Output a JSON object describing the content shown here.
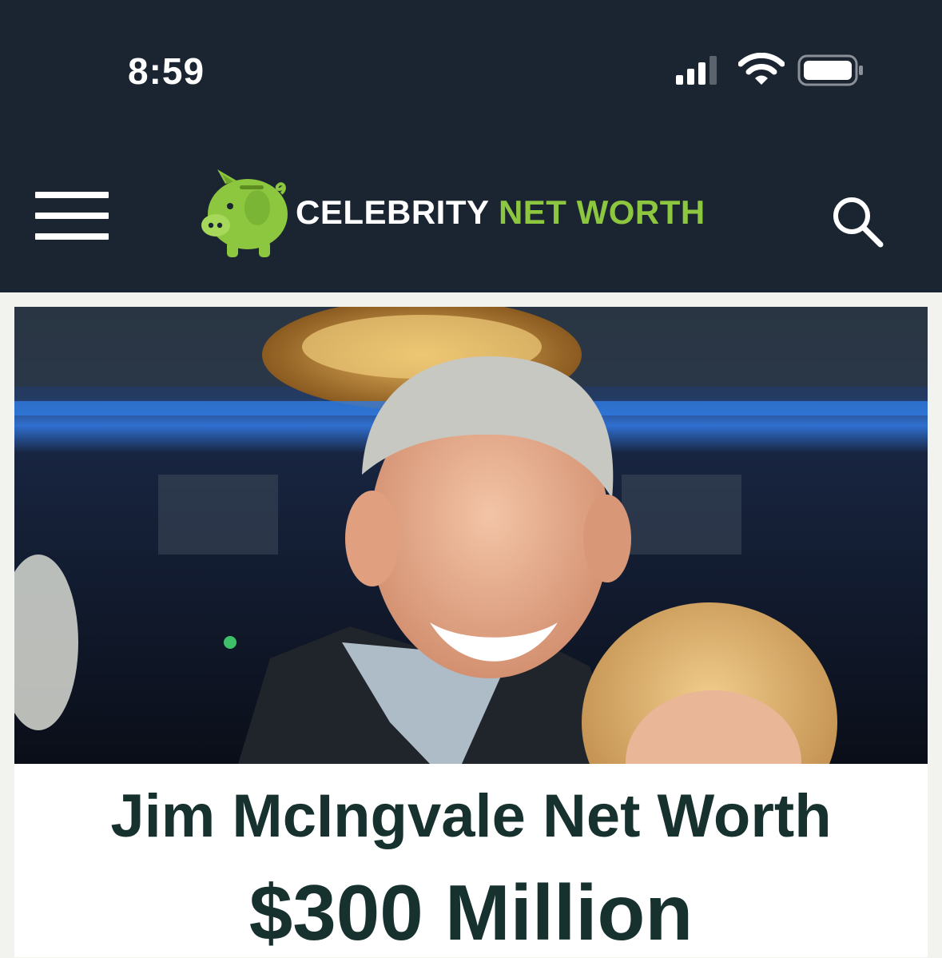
{
  "status_bar": {
    "time": "8:59",
    "icons": [
      "signal-icon",
      "wifi-icon",
      "battery-icon"
    ]
  },
  "header": {
    "menu_icon": "hamburger-menu-icon",
    "logo": {
      "icon": "piggy-bank-icon",
      "word_celebrity": "CELEBRITY",
      "word_net": "NET",
      "word_worth": "WORTH"
    },
    "search_icon": "search-icon"
  },
  "hero_image": {
    "icon": "photo-jim-mcingvale-and-woman"
  },
  "article": {
    "title": "Jim McIngvale Net Worth",
    "net_worth": "$300 Million"
  },
  "colors": {
    "header_bg": "#1b2531",
    "brand_green": "#8dc63f",
    "title_text": "#17312f",
    "page_bg": "#f2f2ef",
    "card_bg": "#ffffff"
  }
}
